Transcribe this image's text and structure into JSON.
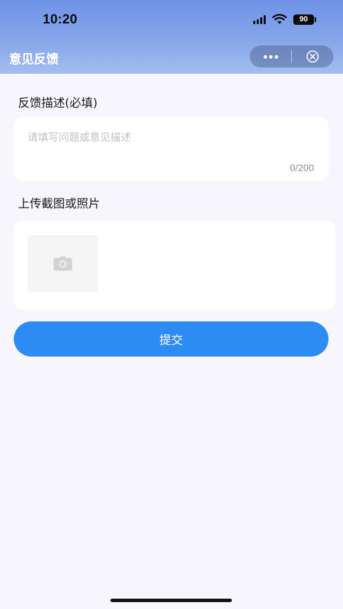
{
  "status_bar": {
    "time": "10:20",
    "battery": "90",
    "icons": [
      "signal-icon",
      "wifi-icon",
      "battery-icon"
    ]
  },
  "nav": {
    "title": "意见反馈",
    "capsule_icons": [
      "more-icon",
      "close-circle-icon"
    ]
  },
  "feedback": {
    "label": "反馈描述(必填)",
    "placeholder": "请填写问题或意见描述",
    "value": "",
    "counter": "0/200"
  },
  "upload": {
    "label": "上传截图或照片",
    "icon": "camera-icon"
  },
  "submit": {
    "label": "提交"
  },
  "colors": {
    "header_gradient_top": "#6f93e6",
    "header_gradient_bottom": "#a2bdf0",
    "page_background": "#f6f6fc",
    "primary_button": "#2c8cf4"
  }
}
